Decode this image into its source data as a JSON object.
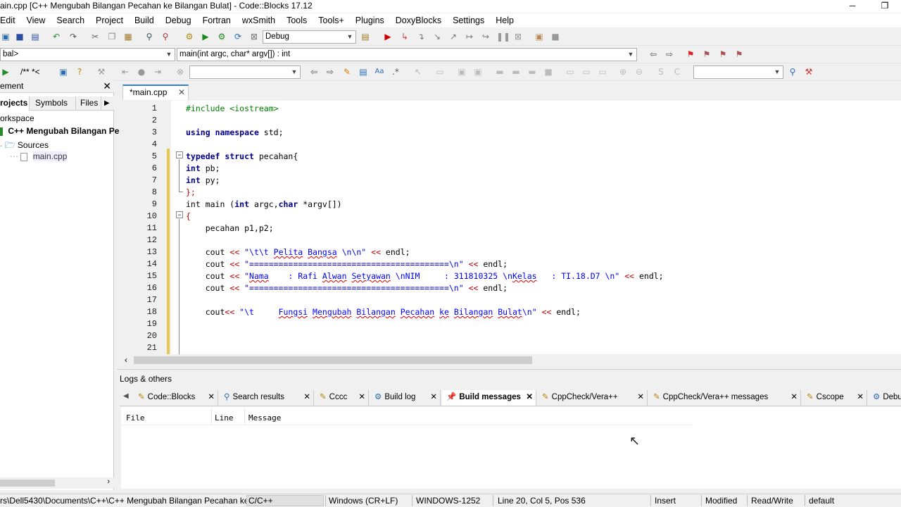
{
  "window": {
    "title": "ain.cpp [C++ Mengubah Bilangan Pecahan ke Bilangan Bulat] - Code::Blocks 17.12",
    "restore_glyph": "❐",
    "minimize_glyph": "─"
  },
  "menu": [
    "Edit",
    "View",
    "Search",
    "Project",
    "Build",
    "Debug",
    "Fortran",
    "wxSmith",
    "Tools",
    "Tools+",
    "Plugins",
    "DoxyBlocks",
    "Settings",
    "Help"
  ],
  "toolbar": {
    "build_target": "Debug",
    "scope": "bal>",
    "function": "main(int argc, char* argv[]) : int",
    "comment_label": "/** *<",
    "search_combo": "",
    "right_combo": ""
  },
  "icons": {
    "new": "new-file-icon",
    "open": "open-icon",
    "save": "save-icon",
    "run": "run-icon"
  },
  "management": {
    "title": "ement",
    "tabs": [
      "rojects",
      "Symbols",
      "Files"
    ],
    "workspace": "orkspace",
    "project": "C++ Mengubah Bilangan Pe",
    "sources": "Sources",
    "file": "main.cpp"
  },
  "editor": {
    "tab": "*main.cpp",
    "line_numbers": [
      "1",
      "2",
      "3",
      "4",
      "5",
      "6",
      "7",
      "8",
      "9",
      "10",
      "11",
      "12",
      "13",
      "14",
      "15",
      "16",
      "17",
      "18",
      "19",
      "20",
      "21"
    ]
  },
  "code": {
    "l1": "#include <iostream>",
    "l3a": "using",
    "l3b": " ",
    "l3c": "namespace",
    "l3d": " std;",
    "l5a": "typedef",
    "l5b": " ",
    "l5c": "struct",
    "l5d": " pecahan{",
    "l6a": "int",
    "l6b": " pb;",
    "l7a": "int",
    "l7b": " py;",
    "l8": "};",
    "l9a": "int main (",
    "l9b": "int",
    "l9c": " argc,",
    "l9d": "char",
    "l9e": " *argv[])",
    "l10": "{",
    "l11": "    pecahan p1,p2;",
    "l13a": "    cout ",
    "l13b": "<<",
    "l13c": " \"\\t\\t ",
    "l13d": "Pelita",
    "l13e": " ",
    "l13f": "Bangsa",
    "l13g": " \\n\\n\" ",
    "l13h": "<<",
    "l13i": " endl;",
    "l14a": "    cout ",
    "l14b": "<<",
    "l14c": " \"=========================================\\n\" ",
    "l14d": "<<",
    "l14e": " endl;",
    "l15a": "    cout ",
    "l15b": "<<",
    "l15c": " \"",
    "l15d": "Nama",
    "l15e": "    : Rafi ",
    "l15f": "Alwan",
    "l15g": " ",
    "l15h": "Setyawan",
    "l15i": " \\nNIM     : 311810325 \\n",
    "l15j": "Kelas",
    "l15k": "   : TI.18.D7 \\n\" ",
    "l15l": "<<",
    "l15m": " endl;",
    "l16a": "    cout ",
    "l16b": "<<",
    "l16c": " \"=========================================\\n\" ",
    "l16d": "<<",
    "l16e": " endl;",
    "l18a": "    cout",
    "l18b": "<<",
    "l18c": " \"\\t     ",
    "l18d": "Fungsi",
    "l18e": " ",
    "l18f": "Mengubah",
    "l18g": " ",
    "l18h": "Bilangan",
    "l18i": " ",
    "l18j": "Pecahan",
    "l18k": " ",
    "l18l": "ke",
    "l18m": " ",
    "l18n": "Bilangan",
    "l18o": " ",
    "l18p": "Bulat",
    "l18q": "\\n\" ",
    "l18r": "<<",
    "l18s": " endl;"
  },
  "logs": {
    "title": "Logs & others",
    "tabs": [
      "Code::Blocks",
      "Search results",
      "Cccc",
      "Build log",
      "Build messages",
      "CppCheck/Vera++",
      "CppCheck/Vera++ messages",
      "Cscope",
      "Debu"
    ],
    "columns": [
      "File",
      "Line",
      "Message"
    ]
  },
  "status": {
    "path": "rs\\Dell5430\\Documents\\C++\\C++ Mengubah Bilangan Pecahan ke",
    "lang": "C/C++",
    "eol": "Windows (CR+LF)",
    "encoding": "WINDOWS-1252",
    "position": "Line 20, Col 5, Pos 536",
    "mode": "Insert",
    "modified": "Modified",
    "access": "Read/Write",
    "profile": "default"
  }
}
